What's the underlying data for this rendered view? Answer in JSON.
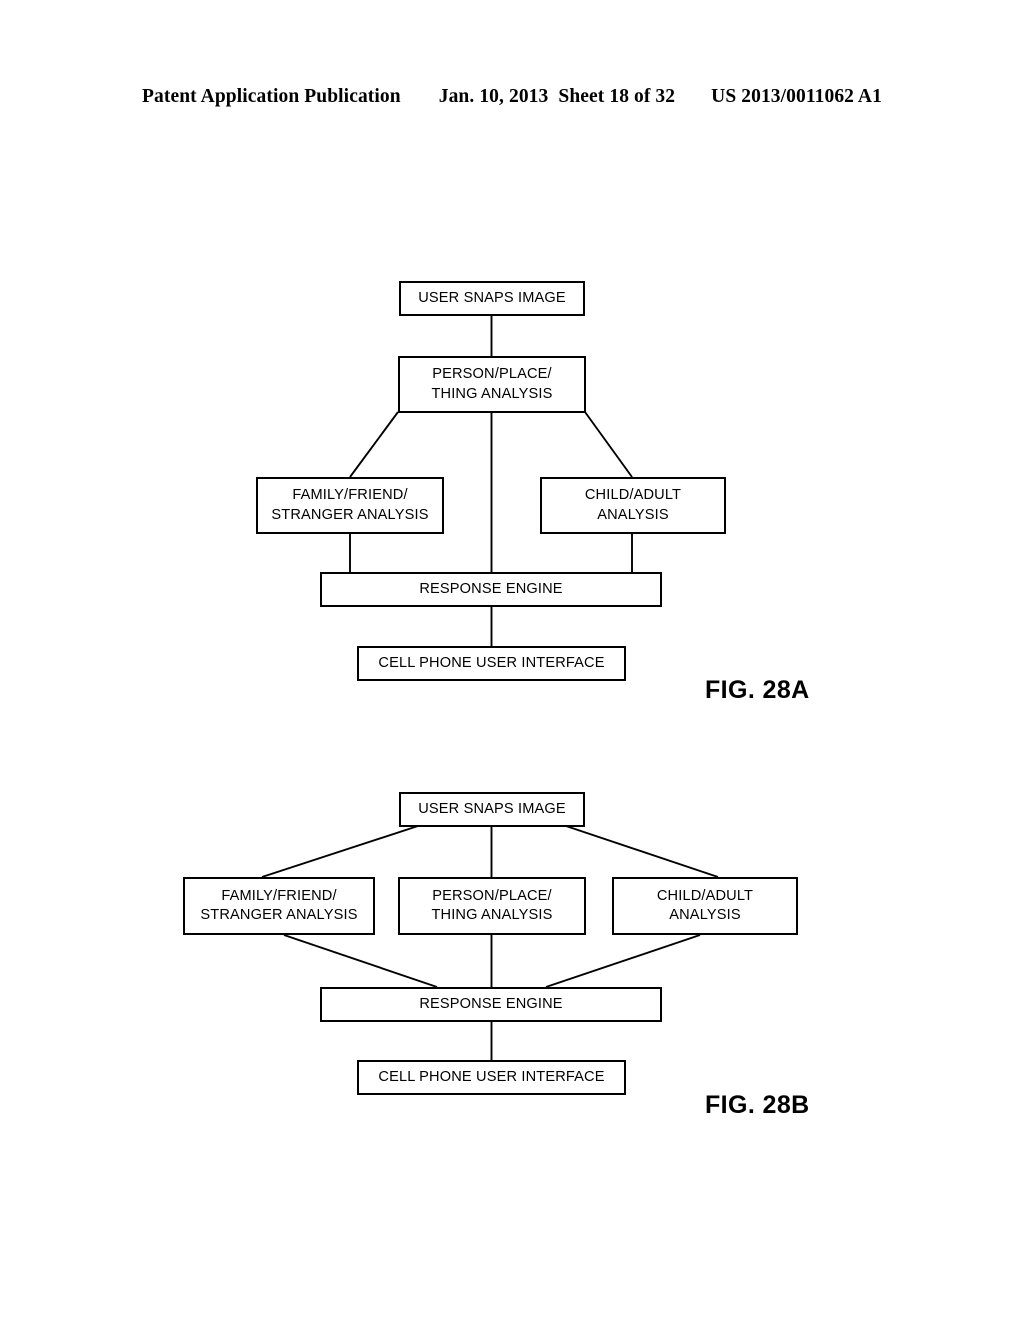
{
  "header": {
    "publication": "Patent Application Publication",
    "date": "Jan. 10, 2013",
    "sheet": "Sheet 18 of 32",
    "document_number": "US 2013/0011062 A1"
  },
  "figures": [
    {
      "id": "fig-28a",
      "caption": "FIG. 28A",
      "nodes": [
        {
          "id": "a-user-snaps-image",
          "label": "USER SNAPS IMAGE"
        },
        {
          "id": "a-person-place-thing",
          "label": "PERSON/PLACE/\nTHING ANALYSIS"
        },
        {
          "id": "a-family-friend-stranger",
          "label": "FAMILY/FRIEND/\nSTRANGER ANALYSIS"
        },
        {
          "id": "a-child-adult",
          "label": "CHILD/ADULT\nANALYSIS"
        },
        {
          "id": "a-response-engine",
          "label": "RESPONSE ENGINE"
        },
        {
          "id": "a-cell-phone-ui",
          "label": "CELL PHONE USER INTERFACE"
        }
      ]
    },
    {
      "id": "fig-28b",
      "caption": "FIG. 28B",
      "nodes": [
        {
          "id": "b-user-snaps-image",
          "label": "USER SNAPS IMAGE"
        },
        {
          "id": "b-family-friend-stranger",
          "label": "FAMILY/FRIEND/\nSTRANGER ANALYSIS"
        },
        {
          "id": "b-person-place-thing",
          "label": "PERSON/PLACE/\nTHING ANALYSIS"
        },
        {
          "id": "b-child-adult",
          "label": "CHILD/ADULT\nANALYSIS"
        },
        {
          "id": "b-response-engine",
          "label": "RESPONSE ENGINE"
        },
        {
          "id": "b-cell-phone-ui",
          "label": "CELL PHONE USER INTERFACE"
        }
      ]
    }
  ],
  "style": {
    "ink": "#000000",
    "paper": "#ffffff"
  }
}
